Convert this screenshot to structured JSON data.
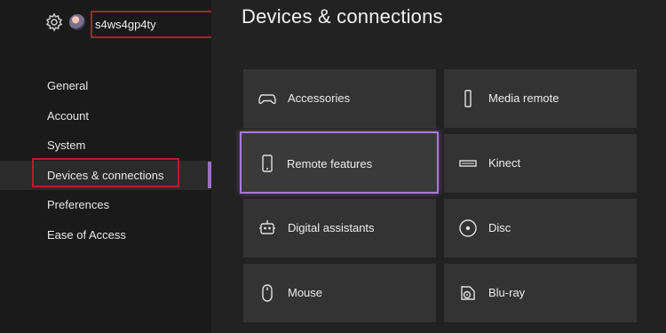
{
  "header": {
    "gamertag": "s4ws4gp4ty"
  },
  "sidebar": {
    "items": [
      {
        "label": "General"
      },
      {
        "label": "Account"
      },
      {
        "label": "System"
      },
      {
        "label": "Devices & connections",
        "selected": true
      },
      {
        "label": "Preferences"
      },
      {
        "label": "Ease of Access"
      }
    ]
  },
  "main": {
    "title": "Devices & connections",
    "tiles": [
      {
        "label": "Accessories",
        "icon": "controller-icon"
      },
      {
        "label": "Media remote",
        "icon": "remote-icon"
      },
      {
        "label": "Remote features",
        "icon": "phone-icon",
        "focused": true
      },
      {
        "label": "Kinect",
        "icon": "kinect-icon"
      },
      {
        "label": "Digital assistants",
        "icon": "assistant-icon"
      },
      {
        "label": "Disc",
        "icon": "disc-icon"
      },
      {
        "label": "Mouse",
        "icon": "mouse-icon"
      },
      {
        "label": "Blu-ray",
        "icon": "bluray-icon"
      }
    ]
  },
  "colors": {
    "accent": "#a77bd6",
    "highlight_box": "#b21f2d",
    "tile_bg": "#333333",
    "background": "#1c1c1c"
  }
}
